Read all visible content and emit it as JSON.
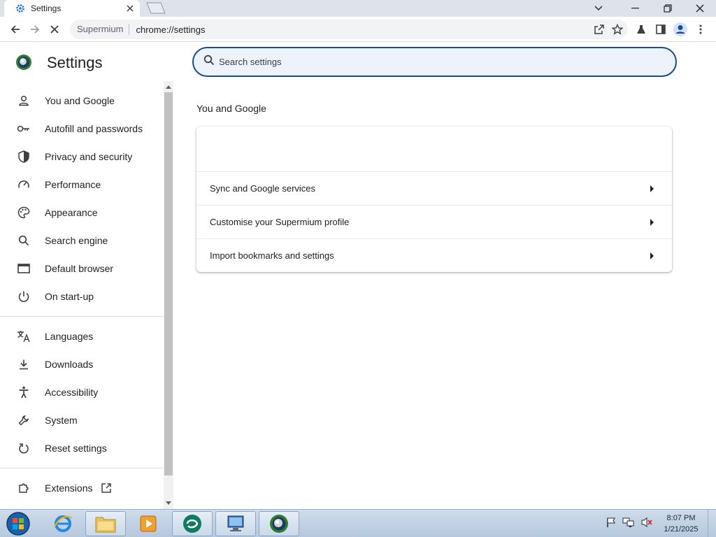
{
  "browser": {
    "tab_title": "Settings",
    "address_chip": "Supermium",
    "address_url": "chrome://settings"
  },
  "settings": {
    "title": "Settings",
    "search_placeholder": "Search settings"
  },
  "sidebar": {
    "items": [
      {
        "label": "You and Google",
        "icon": "person-icon"
      },
      {
        "label": "Autofill and passwords",
        "icon": "key-icon"
      },
      {
        "label": "Privacy and security",
        "icon": "shield-icon"
      },
      {
        "label": "Performance",
        "icon": "speedometer-icon"
      },
      {
        "label": "Appearance",
        "icon": "palette-icon"
      },
      {
        "label": "Search engine",
        "icon": "search-icon"
      },
      {
        "label": "Default browser",
        "icon": "browser-window-icon"
      },
      {
        "label": "On start-up",
        "icon": "power-icon"
      },
      {
        "label": "Languages",
        "icon": "translate-icon"
      },
      {
        "label": "Downloads",
        "icon": "download-icon"
      },
      {
        "label": "Accessibility",
        "icon": "accessibility-icon"
      },
      {
        "label": "System",
        "icon": "wrench-icon"
      },
      {
        "label": "Reset settings",
        "icon": "reset-icon"
      },
      {
        "label": "Extensions",
        "icon": "puzzle-icon"
      }
    ]
  },
  "main": {
    "section_title": "You and Google",
    "rows": [
      {
        "label": "Sync and Google services"
      },
      {
        "label": "Customise your Supermium profile"
      },
      {
        "label": "Import bookmarks and settings"
      }
    ]
  },
  "taskbar": {
    "time": "8:07 PM",
    "date": "1/21/2025"
  },
  "colors": {
    "accent": "#1a73e8",
    "search_border": "#1a4d8f",
    "tab_strip": "#dee3ea"
  }
}
